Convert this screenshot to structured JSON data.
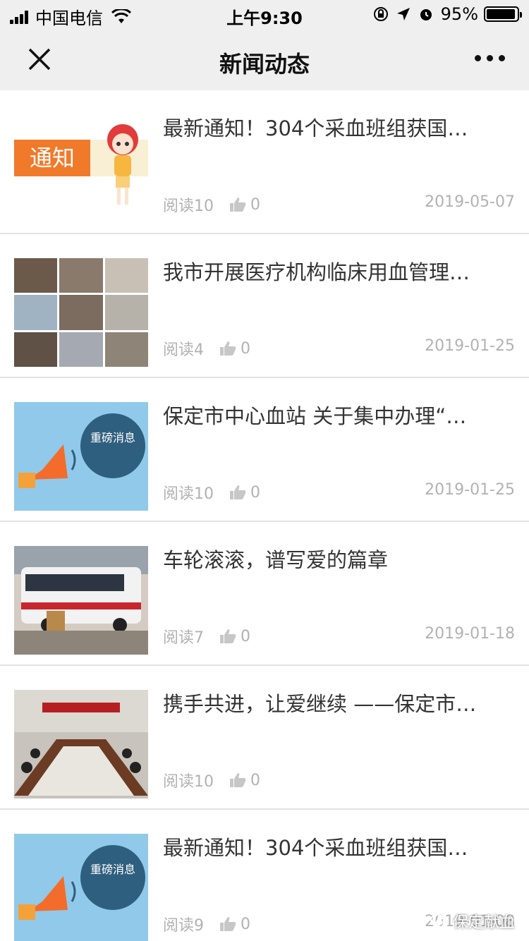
{
  "status_bar": {
    "carrier": "中国电信",
    "time": "上午9:30",
    "battery": "95%",
    "battery_level": 0.95
  },
  "nav": {
    "title": "新闻动态"
  },
  "articles": [
    {
      "title": "最新通知！304个采血班组获国…",
      "reads": "阅读10",
      "likes": "0",
      "date": "2019-05-07",
      "thumb_text": "通知"
    },
    {
      "title": "我市开展医疗机构临床用血管理…",
      "reads": "阅读4",
      "likes": "0",
      "date": "2019-01-25"
    },
    {
      "title": "保定市中心血站 关于集中办理“…",
      "reads": "阅读10",
      "likes": "0",
      "date": "2019-01-25",
      "thumb_text": "重磅消息"
    },
    {
      "title": "车轮滚滚，谱写爱的篇章",
      "reads": "阅读7",
      "likes": "0",
      "date": "2019-01-18"
    },
    {
      "title": "携手共进，让爱继续 ——保定市…",
      "reads": "阅读10",
      "likes": "0",
      "date": ""
    },
    {
      "title": "最新通知！304个采血班组获国…",
      "reads": "阅读9",
      "likes": "0",
      "date": "2019-01-08",
      "thumb_text": "重磅消息"
    }
  ],
  "watermark": "保定献血",
  "colors": {
    "header_bg": "#efefef",
    "meta_gray": "#b2b2b2",
    "notice_orange": "#f07a2a",
    "banner_blue": "#91c9ea"
  }
}
